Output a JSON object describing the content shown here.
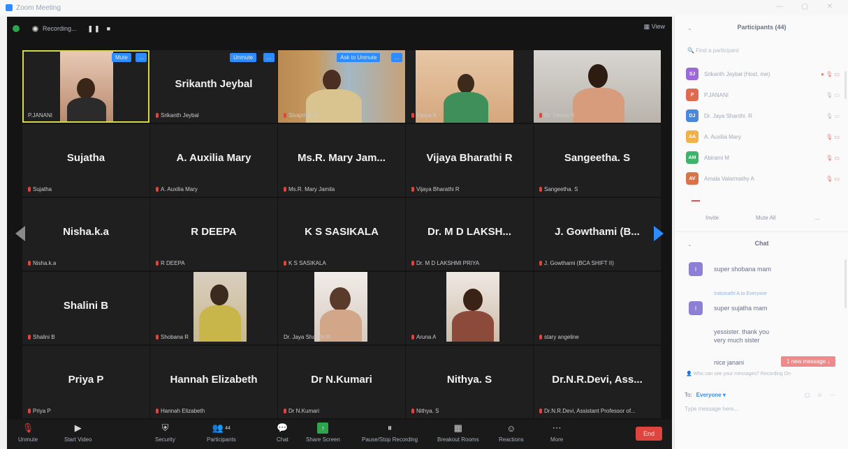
{
  "window": {
    "title": "Zoom Meeting"
  },
  "topbar": {
    "recording_label": "Recording...",
    "pause_label": "❚❚",
    "stop_label": "■",
    "view_label": "View"
  },
  "tiles": [
    {
      "name": "",
      "label": "P.JANANI",
      "btn": "Mute",
      "muted": false
    },
    {
      "name": "Srikanth Jeybal",
      "label": "Srikanth Jeybal",
      "btn": "Unmute",
      "muted": true
    },
    {
      "name": "",
      "label": "Sivapriya S",
      "btn": "Ask to Unmute",
      "muted": true
    },
    {
      "name": "",
      "label": "Vijaya K",
      "btn": "",
      "muted": true
    },
    {
      "name": "",
      "label": "Dr. Deeba K",
      "btn": "",
      "muted": true
    },
    {
      "name": "Sujatha",
      "label": "Sujatha",
      "btn": "",
      "muted": true
    },
    {
      "name": "A. Auxilia Mary",
      "label": "A. Auxilia Mary",
      "btn": "",
      "muted": true
    },
    {
      "name": "Ms.R. Mary Jam...",
      "label": "Ms.R. Mary Jamila",
      "btn": "",
      "muted": true
    },
    {
      "name": "Vijaya Bharathi R",
      "label": "Vijaya Bharathi R",
      "btn": "",
      "muted": true
    },
    {
      "name": "Sangeetha. S",
      "label": "Sangeetha. S",
      "btn": "",
      "muted": true
    },
    {
      "name": "Nisha.k.a",
      "label": "Nisha.k.a",
      "btn": "",
      "muted": true
    },
    {
      "name": "R DEEPA",
      "label": "R DEEPA",
      "btn": "",
      "muted": true
    },
    {
      "name": "K S SASIKALA",
      "label": "K S SASIKALA",
      "btn": "",
      "muted": true
    },
    {
      "name": "Dr. M D LAKSH...",
      "label": "Dr. M D LAKSHMI PRIYA",
      "btn": "",
      "muted": true
    },
    {
      "name": "J. Gowthami (B...",
      "label": "J. Gowthami (BCA SHIFT II)",
      "btn": "",
      "muted": true
    },
    {
      "name": "Shalini B",
      "label": "Shalini B",
      "btn": "",
      "muted": true
    },
    {
      "name": "",
      "label": "Shobana R",
      "btn": "",
      "muted": true
    },
    {
      "name": "",
      "label": "Dr. Jaya Shanthi R",
      "btn": "",
      "muted": false
    },
    {
      "name": "",
      "label": "Aruna A",
      "btn": "",
      "muted": true
    },
    {
      "name": "",
      "label": "stary angeline",
      "btn": "",
      "muted": true
    },
    {
      "name": "Priya P",
      "label": "Priya P",
      "btn": "",
      "muted": true
    },
    {
      "name": "Hannah Elizabeth",
      "label": "Hannah Elizabeth",
      "btn": "",
      "muted": true
    },
    {
      "name": "Dr N.Kumari",
      "label": "Dr N.Kumari",
      "btn": "",
      "muted": true
    },
    {
      "name": "Nithya. S",
      "label": "Nithya. S",
      "btn": "",
      "muted": true
    },
    {
      "name": "Dr.N.R.Devi,  Ass...",
      "label": "Dr.N.R.Devi, Assistant Professor of...",
      "btn": "",
      "muted": true
    }
  ],
  "toolbar": {
    "unmute": "Unmute",
    "start_video": "Start Video",
    "security": "Security",
    "participants": "Participants",
    "participants_count": "44",
    "chat": "Chat",
    "share_screen": "Share Screen",
    "pause_recording": "Pause/Stop Recording",
    "breakout": "Breakout Rooms",
    "reactions": "Reactions",
    "more": "More",
    "end": "End"
  },
  "participants_panel": {
    "title": "Participants (44)",
    "search_placeholder": "Find a participant",
    "items": [
      {
        "initials": "SJ",
        "name": "Srikanth Jeybal (Host, me)",
        "color": "#9b6ad6"
      },
      {
        "initials": "P",
        "name": "P.JANANI",
        "color": "#e06a4f"
      },
      {
        "initials": "DJ",
        "name": "Dr. Jaya Shanthi. R",
        "color": "#4d87d9"
      },
      {
        "initials": "AA",
        "name": "A. Auxilia Mary",
        "color": "#f0b04a"
      },
      {
        "initials": "AM",
        "name": "Abirami M",
        "color": "#3fb36b"
      },
      {
        "initials": "AV",
        "name": "Amala Valarmathy A",
        "color": "#d9734a"
      }
    ],
    "invite": "Invite",
    "mute_all": "Mute All",
    "more": "..."
  },
  "chat_panel": {
    "title": "Chat",
    "messages": [
      {
        "avatar": "I",
        "text": "super shobana mam"
      },
      {
        "avatar": "I",
        "text": "super  sujatha mam"
      },
      {
        "avatar": "",
        "text": "yessister. thank you"
      },
      {
        "avatar": "",
        "text": "very much sister"
      },
      {
        "avatar": "",
        "text": "nice janani"
      }
    ],
    "sender": "Indumathi A to Everyone",
    "new_message": "1 new message ↓",
    "who_can_see": "Who can see your messages? Recording On",
    "to_label": "To:",
    "to_value": "Everyone ▾",
    "type_placeholder": "Type message here..."
  }
}
